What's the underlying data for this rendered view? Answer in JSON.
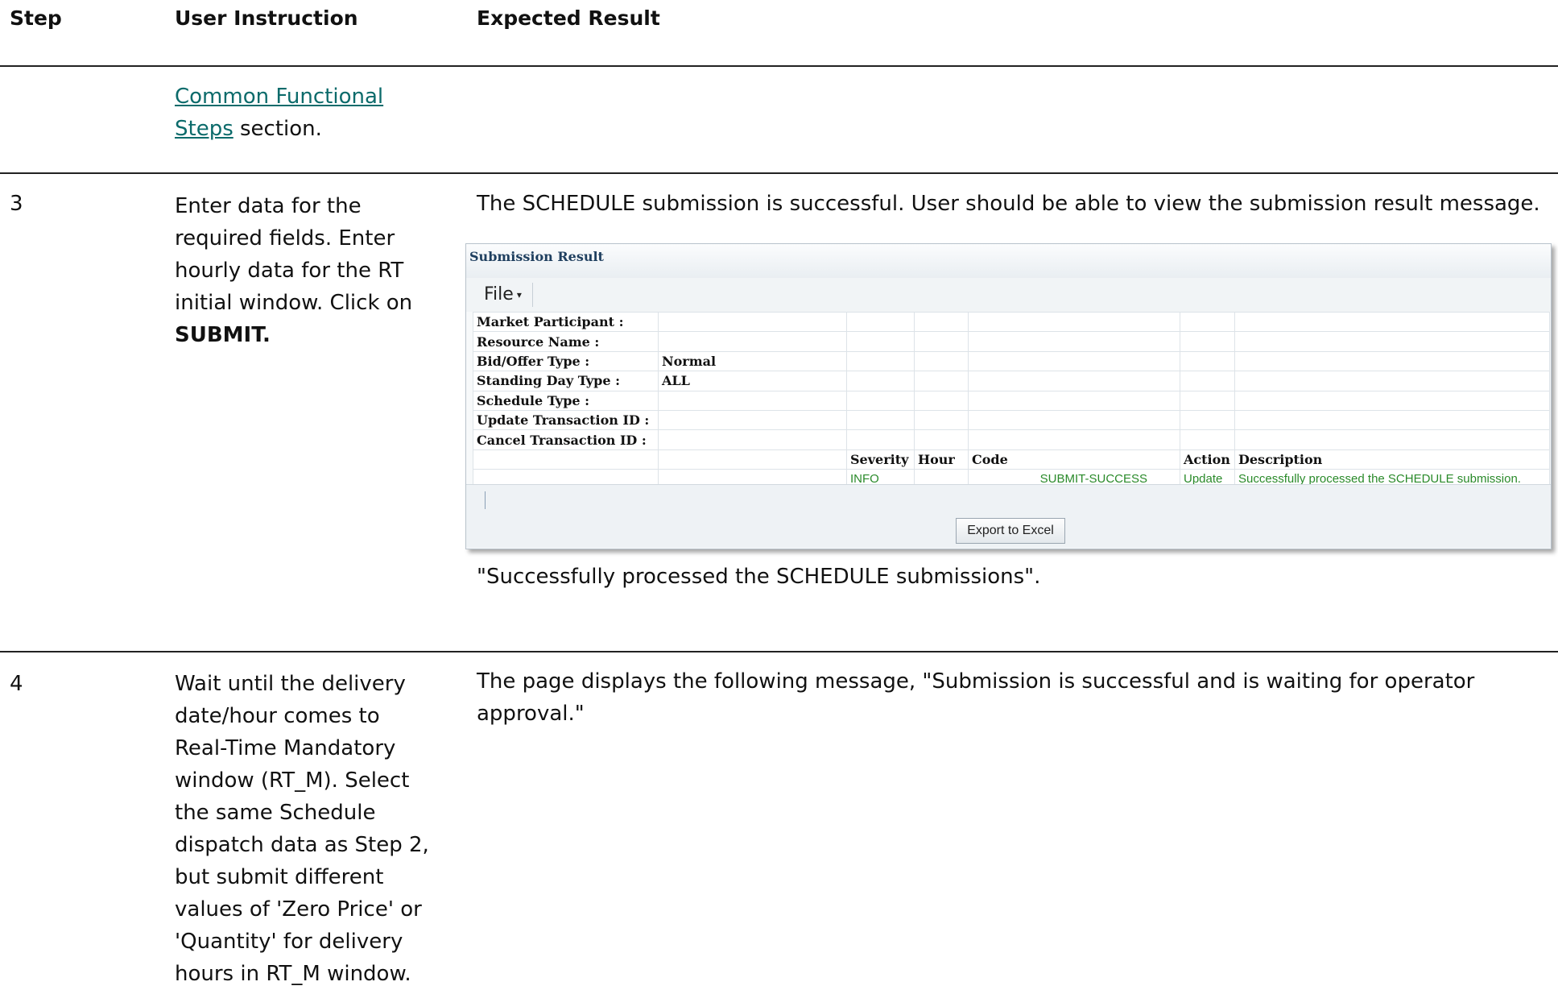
{
  "header": {
    "step": "Step",
    "instruction": "User Instruction",
    "expected": "Expected Result"
  },
  "row_prev": {
    "link_line1": "Common Functional",
    "link_line2": "Steps",
    "tail": " section."
  },
  "row3": {
    "step": "3",
    "instruction_lines": [
      "Enter data for the",
      "required fields. Enter",
      "hourly data for the RT",
      "initial window. Click on"
    ],
    "instruction_bold": "SUBMIT.",
    "expected": "The SCHEDULE submission is successful. User should be able to view the submission result message.",
    "after_image": "\"Successfully processed the SCHEDULE submissions\"."
  },
  "panel": {
    "title": "Submission Result",
    "file_menu": "File",
    "labels": [
      "Market Participant :",
      "Resource Name :",
      "Bid/Offer Type :",
      "Standing Day Type :",
      "Schedule Type :",
      "Update Transaction ID :",
      "Cancel Transaction ID :"
    ],
    "values": [
      "",
      "",
      "Normal",
      "ALL",
      "",
      "",
      ""
    ],
    "columns": {
      "severity": "Severity",
      "hour": "Hour",
      "code": "Code",
      "action": "Action",
      "description": "Description"
    },
    "result": {
      "severity": "INFO",
      "hour": "",
      "code": "SUBMIT-SUCCESS",
      "action": "Update",
      "description": "Successfully processed the SCHEDULE submission."
    },
    "export_button": "Export to Excel",
    "colors": {
      "success_text": "#2a8a2a",
      "title_text": "#1f3f5f"
    }
  },
  "row4": {
    "step": "4",
    "instruction_lines": [
      "Wait until the delivery",
      "date/hour comes to",
      "Real-Time Mandatory",
      "window (RT_M). Select",
      "the same Schedule",
      "dispatch data as Step 2,",
      "but submit  different",
      "values of 'Zero Price' or",
      "'Quantity' for delivery",
      "hours in RT_M window."
    ],
    "expected_lines": [
      "The page displays the following message, \"Submission is successful and is waiting for operator",
      "approval.\""
    ]
  },
  "link_color": "#0c6b6b"
}
